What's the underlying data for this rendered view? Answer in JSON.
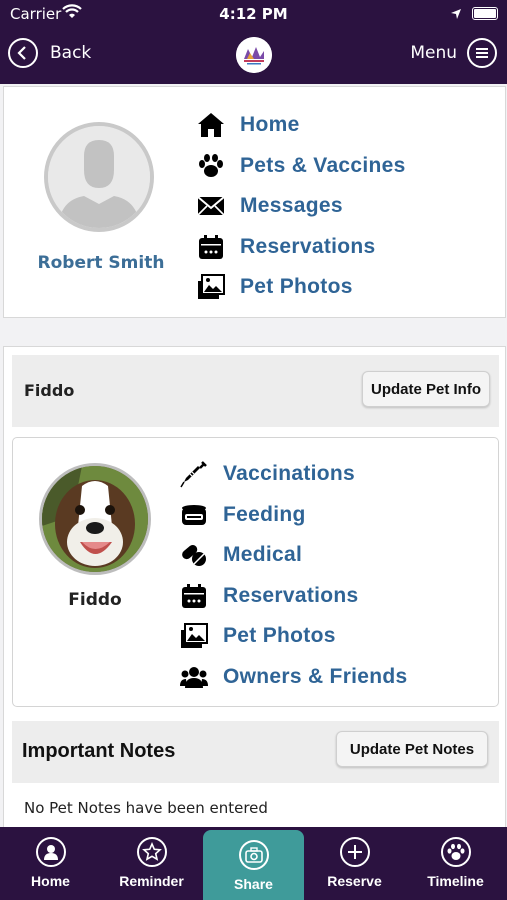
{
  "status_bar": {
    "carrier": "Carrier",
    "time": "4:12 PM"
  },
  "nav": {
    "back_label": "Back",
    "menu_label": "Menu"
  },
  "owner": {
    "name": "Robert Smith",
    "menu": [
      {
        "label": "Home",
        "icon": "home-icon"
      },
      {
        "label": "Pets & Vaccines",
        "icon": "paw-icon"
      },
      {
        "label": "Messages",
        "icon": "envelope-icon"
      },
      {
        "label": "Reservations",
        "icon": "calendar-icon"
      },
      {
        "label": "Pet Photos",
        "icon": "photos-icon"
      }
    ]
  },
  "pet": {
    "header_name": "Fiddo",
    "update_info_label": "Update Pet Info",
    "avatar_name": "Fiddo",
    "menu": [
      {
        "label": "Vaccinations",
        "icon": "syringe-icon"
      },
      {
        "label": "Feeding",
        "icon": "food-bowl-icon"
      },
      {
        "label": "Medical",
        "icon": "pills-icon"
      },
      {
        "label": "Reservations",
        "icon": "calendar-icon"
      },
      {
        "label": "Pet Photos",
        "icon": "photos-icon"
      },
      {
        "label": "Owners & Friends",
        "icon": "users-icon"
      }
    ]
  },
  "notes": {
    "title": "Important Notes",
    "update_label": "Update Pet Notes",
    "empty_text": "No Pet Notes have been entered"
  },
  "tabs": [
    {
      "label": "Home",
      "icon": "user-icon"
    },
    {
      "label": "Reminder",
      "icon": "star-icon"
    },
    {
      "label": "Share",
      "icon": "camera-icon",
      "active": true
    },
    {
      "label": "Reserve",
      "icon": "plus-icon"
    },
    {
      "label": "Timeline",
      "icon": "paw-icon"
    }
  ],
  "colors": {
    "brand": "#2b1240",
    "link": "#2f6496",
    "active_tab": "#3f9b9a"
  }
}
